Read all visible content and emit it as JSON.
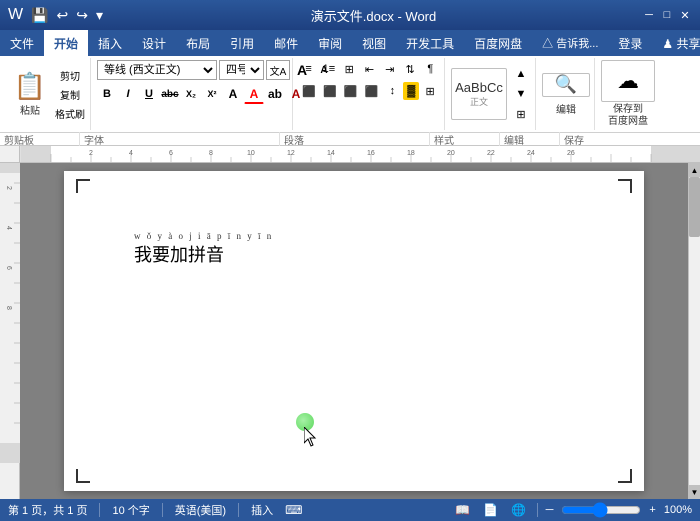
{
  "titlebar": {
    "title": "演示文件.docx - Word",
    "quick_access": [
      "💾",
      "↩",
      "↪"
    ],
    "window_controls": [
      "─",
      "□",
      "✕"
    ]
  },
  "menubar": {
    "items": [
      "文件",
      "开始",
      "插入",
      "设计",
      "布局",
      "引用",
      "邮件",
      "审阅",
      "视图",
      "开发工具",
      "百度网盘"
    ],
    "active": "开始",
    "right_items": [
      "△ 告诉我...",
      "登录",
      "♟ 共享"
    ]
  },
  "ribbon": {
    "groups": [
      {
        "name": "剪贴板",
        "label": "剪贴板"
      },
      {
        "name": "字体",
        "label": "字体"
      },
      {
        "name": "段落",
        "label": "段落"
      },
      {
        "name": "样式",
        "label": "样式"
      },
      {
        "name": "编辑",
        "label": "编辑"
      },
      {
        "name": "保存到百度网盘",
        "label": "保存"
      }
    ],
    "font_name": "等线 (西文正文)",
    "font_size": "四号",
    "paste_label": "粘贴",
    "cut_label": "剪切",
    "copy_label": "复制",
    "format_painter": "格式刷",
    "bold": "B",
    "italic": "I",
    "underline": "U",
    "strikethrough": "abc",
    "subscript": "X₂",
    "superscript": "X²",
    "style_label": "样式",
    "edit_label": "编辑",
    "save_label": "保存到\n百度网盘",
    "wen_label": "文A"
  },
  "document": {
    "pinyin": "w ǒ y à o j i ā p ī n y ī n",
    "text": "我要加拼音",
    "page_info": "第 1 页，共 1 页",
    "word_count": "10 个字",
    "language": "英语(美国)",
    "mode": "插入",
    "view_pct": "100%"
  },
  "statusbar": {
    "page": "第 1 页，共 1 页",
    "words": "10 个字",
    "language": "英语(美国)",
    "mode": "插入",
    "zoom": "100%"
  }
}
